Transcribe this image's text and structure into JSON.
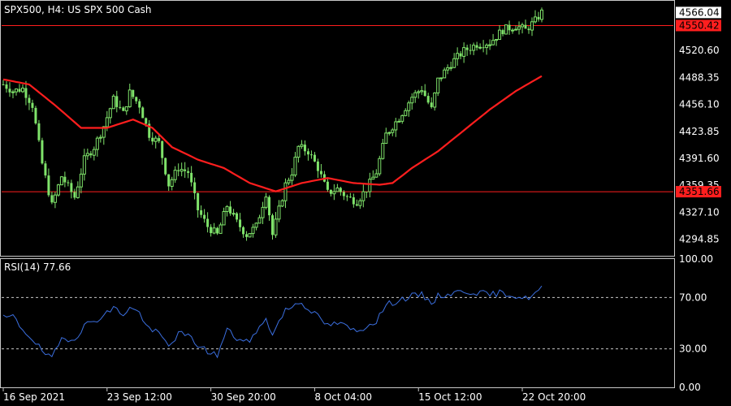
{
  "window": {
    "title": "SPX500, H4:  US SPX 500 Cash"
  },
  "colors": {
    "background": "#000000",
    "frame": "#c8c8c8",
    "bull_candle": "#7fe36a",
    "bear_candle": "#7fe36a",
    "moving_average": "#ff1e1e",
    "horizontal_level": "#ff1e1e",
    "rsi_line": "#3b6fe0",
    "rsi_levels": "#c8c8c8",
    "current_price_bg": "#ffffff",
    "level_label_bg": "#ff1e1e"
  },
  "chart_data": [
    {
      "type": "candlestick",
      "title": "SPX500, H4:  US SPX 500 Cash",
      "ylim": [
        4275,
        4580
      ],
      "y_ticks": [
        "4566.04",
        "4520.60",
        "4488.35",
        "4456.10",
        "4423.85",
        "4391.60",
        "4359.35",
        "4327.10",
        "4294.85"
      ],
      "y_tick_values": [
        4566.04,
        4520.6,
        4488.35,
        4456.1,
        4423.85,
        4391.6,
        4359.35,
        4327.1,
        4294.85
      ],
      "x_ticks": [
        "16 Sep 2021",
        "23 Sep 12:00",
        "30 Sep 20:00",
        "8 Oct 04:00",
        "15 Oct 12:00",
        "22 Oct 20:00"
      ],
      "x_tick_bar_index": [
        0,
        32,
        64,
        96,
        128,
        160
      ],
      "current_price": {
        "label": "4566.04",
        "value": 4566.04
      },
      "levels": [
        {
          "label": "4550.42",
          "value": 4550.42
        },
        {
          "label": "4351.66",
          "value": 4351.66
        }
      ],
      "close_waypoints": [
        [
          0,
          4480
        ],
        [
          3,
          4472
        ],
        [
          6,
          4475
        ],
        [
          9,
          4455
        ],
        [
          12,
          4385
        ],
        [
          15,
          4335
        ],
        [
          18,
          4370
        ],
        [
          22,
          4345
        ],
        [
          25,
          4390
        ],
        [
          28,
          4405
        ],
        [
          31,
          4430
        ],
        [
          34,
          4462
        ],
        [
          37,
          4445
        ],
        [
          39,
          4470
        ],
        [
          42,
          4455
        ],
        [
          45,
          4420
        ],
        [
          48,
          4410
        ],
        [
          51,
          4360
        ],
        [
          54,
          4380
        ],
        [
          57,
          4375
        ],
        [
          60,
          4330
        ],
        [
          63,
          4310
        ],
        [
          66,
          4300
        ],
        [
          69,
          4335
        ],
        [
          72,
          4315
        ],
        [
          75,
          4300
        ],
        [
          78,
          4310
        ],
        [
          81,
          4350
        ],
        [
          83,
          4300
        ],
        [
          85,
          4330
        ],
        [
          87,
          4360
        ],
        [
          89,
          4375
        ],
        [
          91,
          4405
        ],
        [
          94,
          4400
        ],
        [
          97,
          4380
        ],
        [
          100,
          4350
        ],
        [
          103,
          4355
        ],
        [
          106,
          4345
        ],
        [
          109,
          4340
        ],
        [
          112,
          4355
        ],
        [
          115,
          4375
        ],
        [
          118,
          4420
        ],
        [
          122,
          4440
        ],
        [
          126,
          4465
        ],
        [
          129,
          4475
        ],
        [
          132,
          4450
        ],
        [
          134,
          4485
        ],
        [
          138,
          4505
        ],
        [
          142,
          4520
        ],
        [
          146,
          4528
        ],
        [
          150,
          4530
        ],
        [
          154,
          4545
        ],
        [
          158,
          4550
        ],
        [
          161,
          4545
        ],
        [
          164,
          4556
        ],
        [
          166,
          4566
        ]
      ],
      "moving_average_waypoints": [
        [
          0,
          4486
        ],
        [
          8,
          4480
        ],
        [
          16,
          4455
        ],
        [
          24,
          4428
        ],
        [
          32,
          4428
        ],
        [
          40,
          4438
        ],
        [
          46,
          4428
        ],
        [
          52,
          4405
        ],
        [
          60,
          4390
        ],
        [
          68,
          4380
        ],
        [
          76,
          4362
        ],
        [
          84,
          4352
        ],
        [
          92,
          4362
        ],
        [
          100,
          4368
        ],
        [
          108,
          4362
        ],
        [
          116,
          4360
        ],
        [
          120,
          4362
        ],
        [
          126,
          4380
        ],
        [
          134,
          4400
        ],
        [
          142,
          4425
        ],
        [
          150,
          4450
        ],
        [
          158,
          4472
        ],
        [
          166,
          4490
        ]
      ],
      "bar_count": 167
    },
    {
      "type": "line",
      "title": "RSI(14) 77.66",
      "ylim": [
        0,
        100
      ],
      "y_ticks": [
        "100.00",
        "70.00",
        "30.00",
        "0.00"
      ],
      "y_tick_values": [
        100,
        70,
        30,
        0
      ],
      "levels": [
        70,
        30
      ],
      "rsi_waypoints": [
        [
          0,
          54
        ],
        [
          3,
          55
        ],
        [
          6,
          45
        ],
        [
          9,
          38
        ],
        [
          12,
          28
        ],
        [
          15,
          22
        ],
        [
          18,
          38
        ],
        [
          22,
          38
        ],
        [
          25,
          48
        ],
        [
          28,
          52
        ],
        [
          31,
          56
        ],
        [
          34,
          62
        ],
        [
          37,
          57
        ],
        [
          39,
          62
        ],
        [
          42,
          58
        ],
        [
          45,
          45
        ],
        [
          48,
          42
        ],
        [
          51,
          32
        ],
        [
          54,
          42
        ],
        [
          57,
          40
        ],
        [
          60,
          33
        ],
        [
          63,
          28
        ],
        [
          66,
          25
        ],
        [
          69,
          45
        ],
        [
          72,
          38
        ],
        [
          75,
          35
        ],
        [
          78,
          42
        ],
        [
          81,
          55
        ],
        [
          83,
          40
        ],
        [
          85,
          52
        ],
        [
          87,
          60
        ],
        [
          89,
          63
        ],
        [
          91,
          67
        ],
        [
          94,
          62
        ],
        [
          97,
          55
        ],
        [
          100,
          48
        ],
        [
          103,
          50
        ],
        [
          106,
          47
        ],
        [
          109,
          43
        ],
        [
          112,
          48
        ],
        [
          115,
          52
        ],
        [
          118,
          64
        ],
        [
          122,
          68
        ],
        [
          126,
          71
        ],
        [
          129,
          72
        ],
        [
          132,
          66
        ],
        [
          134,
          71
        ],
        [
          138,
          73
        ],
        [
          142,
          75
        ],
        [
          146,
          74
        ],
        [
          150,
          72
        ],
        [
          154,
          74
        ],
        [
          158,
          71
        ],
        [
          161,
          69
        ],
        [
          164,
          73
        ],
        [
          166,
          77.66
        ]
      ]
    }
  ]
}
